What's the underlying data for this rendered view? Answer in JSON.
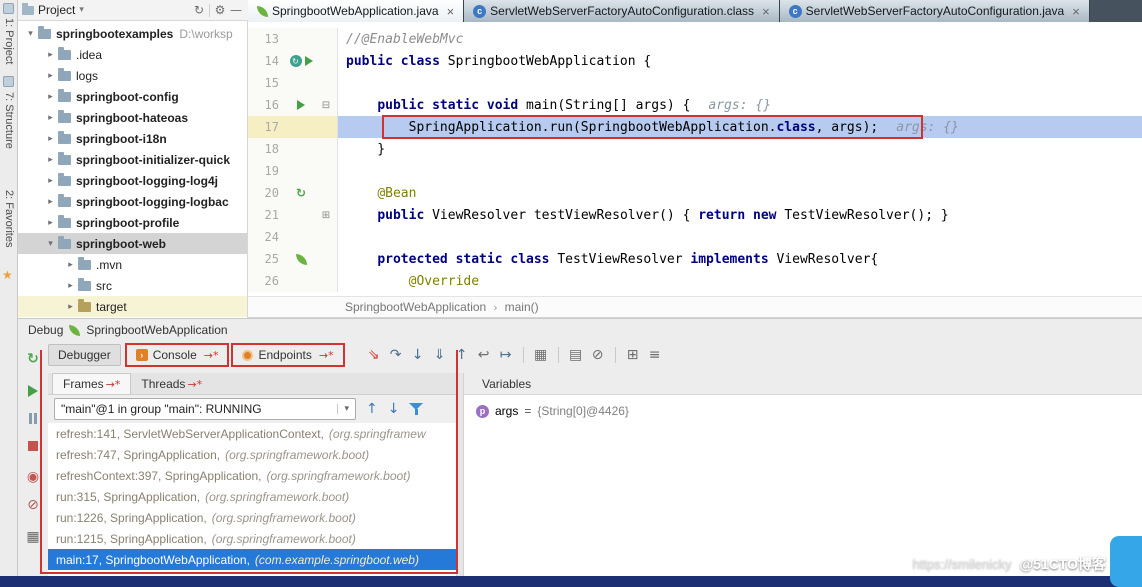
{
  "activity_bar": {
    "project_label": "1: Project",
    "structure_label": "7: Structure",
    "favorites_label": "2: Favorites",
    "star_icon": "★"
  },
  "project_toolbar": {
    "title": "Project",
    "caret": "▾",
    "icons": [
      {
        "name": "sync-icon",
        "g": "↻"
      },
      {
        "name": "settings-icon",
        "g": "⚙"
      },
      {
        "name": "hide-icon",
        "g": "—"
      }
    ]
  },
  "project_tree": {
    "root": {
      "name": "springbootexamples",
      "path": "D:\\worksp"
    },
    "items": [
      {
        "name": ".idea",
        "bold": false,
        "level": 1,
        "expanded": false
      },
      {
        "name": "logs",
        "bold": false,
        "level": 1,
        "expanded": false
      },
      {
        "name": "springboot-config",
        "bold": true,
        "level": 1,
        "expanded": false
      },
      {
        "name": "springboot-hateoas",
        "bold": true,
        "level": 1,
        "expanded": false
      },
      {
        "name": "springboot-i18n",
        "bold": true,
        "level": 1,
        "expanded": false
      },
      {
        "name": "springboot-initializer-quick",
        "bold": true,
        "level": 1,
        "expanded": false
      },
      {
        "name": "springboot-logging-log4j",
        "bold": true,
        "level": 1,
        "expanded": false
      },
      {
        "name": "springboot-logging-logbac",
        "bold": true,
        "level": 1,
        "expanded": false
      },
      {
        "name": "springboot-profile",
        "bold": true,
        "level": 1,
        "expanded": false
      },
      {
        "name": "springboot-web",
        "bold": true,
        "level": 1,
        "expanded": true,
        "selected": true
      },
      {
        "name": ".mvn",
        "bold": false,
        "level": 2,
        "expanded": false
      },
      {
        "name": "src",
        "bold": false,
        "level": 2,
        "expanded": false
      },
      {
        "name": "target",
        "bold": false,
        "level": 2,
        "expanded": false,
        "excluded": true,
        "olive": true
      }
    ]
  },
  "editor_tabs": [
    {
      "label": "SpringbootWebApplication.java",
      "icon": "leaf",
      "active": true
    },
    {
      "label": "ServletWebServerFactoryAutoConfiguration.class",
      "icon": "class",
      "active": false
    },
    {
      "label": "ServletWebServerFactoryAutoConfiguration.java",
      "icon": "class",
      "active": false
    }
  ],
  "editor": {
    "lines": [
      {
        "num": "13",
        "segments": [
          {
            "t": "//@EnableWebMvc",
            "s": "comment"
          }
        ]
      },
      {
        "num": "14",
        "gutter": [
          "rerun",
          "run"
        ],
        "segments": [
          {
            "t": "public class ",
            "s": "kw"
          },
          {
            "t": "SpringbootWebApplication {",
            "s": "plain"
          }
        ]
      },
      {
        "num": "15",
        "segments": []
      },
      {
        "num": "16",
        "gutter": [
          "run"
        ],
        "fold": "⊟",
        "segments": [
          {
            "t": "    ",
            "s": "plain"
          },
          {
            "t": "public static void ",
            "s": "kw"
          },
          {
            "t": "main(String[] args) {",
            "s": "plain"
          },
          {
            "t": "args: {}",
            "s": "hint"
          }
        ]
      },
      {
        "num": "17",
        "current": true,
        "segments": [
          {
            "t": "        ",
            "s": "plain"
          },
          {
            "t": "SpringApplication.run(SpringbootWebApplication.",
            "s": "plain"
          },
          {
            "t": "class",
            "s": "kw"
          },
          {
            "t": ", args);",
            "s": "plain"
          },
          {
            "t": "args: {}",
            "s": "hint"
          }
        ]
      },
      {
        "num": "18",
        "segments": [
          {
            "t": "    }",
            "s": "plain"
          }
        ]
      },
      {
        "num": "19",
        "segments": []
      },
      {
        "num": "20",
        "gutter": [
          "bean"
        ],
        "segments": [
          {
            "t": "    ",
            "s": "plain"
          },
          {
            "t": "@Bean",
            "s": "anno"
          }
        ]
      },
      {
        "num": "21",
        "fold": "⊞",
        "segments": [
          {
            "t": "    ",
            "s": "plain"
          },
          {
            "t": "public ",
            "s": "kw"
          },
          {
            "t": "ViewResolver testViewResolver() { ",
            "s": "plain"
          },
          {
            "t": "return new ",
            "s": "kw"
          },
          {
            "t": "TestViewResolver(); }",
            "s": "plain"
          }
        ]
      },
      {
        "num": "24",
        "segments": []
      },
      {
        "num": "25",
        "gutter": [
          "leaf"
        ],
        "segments": [
          {
            "t": "    ",
            "s": "plain"
          },
          {
            "t": "protected static class ",
            "s": "kw"
          },
          {
            "t": "TestViewResolver ",
            "s": "plain"
          },
          {
            "t": "implements ",
            "s": "kw"
          },
          {
            "t": "ViewResolver{",
            "s": "plain"
          }
        ]
      },
      {
        "num": "26",
        "segments": [
          {
            "t": "        ",
            "s": "plain"
          },
          {
            "t": "@Override",
            "s": "anno"
          }
        ]
      }
    ]
  },
  "breadcrumb": {
    "items": [
      "SpringbootWebApplication",
      "main()"
    ],
    "separator": "›"
  },
  "debug": {
    "header": {
      "label": "Debug",
      "session": "SpringbootWebApplication"
    },
    "tabs": [
      {
        "label": "Debugger",
        "icon": null,
        "selected": true,
        "annotated": false
      },
      {
        "label": "Console",
        "icon": "console",
        "selected": false,
        "annotated": true
      },
      {
        "label": "Endpoints",
        "icon": "endpoints",
        "selected": false,
        "annotated": true
      }
    ],
    "toolbar_icons": [
      {
        "name": "show-execution-point-icon",
        "g": "⇘",
        "style": "red"
      },
      {
        "name": "step-over-icon",
        "g": "↷",
        "style": "blue"
      },
      {
        "name": "step-into-icon",
        "g": "↓",
        "style": "blue"
      },
      {
        "name": "force-step-into-icon",
        "g": "⇓",
        "style": "blue"
      },
      {
        "name": "step-out-icon",
        "g": "↑",
        "style": "blue"
      },
      {
        "name": "drop-frame-icon",
        "g": "↩",
        "style": "gray"
      },
      {
        "name": "run-to-cursor-icon",
        "g": "↦",
        "style": "blue"
      },
      {
        "name": "sep",
        "g": "",
        "style": "sep"
      },
      {
        "name": "evaluate-expression-icon",
        "g": "▦",
        "style": "gray"
      },
      {
        "name": "sep",
        "g": "",
        "style": "sep"
      },
      {
        "name": "thread-dump-icon",
        "g": "▤",
        "style": "gray"
      },
      {
        "name": "mute-breakpoints-icon",
        "g": "⊘",
        "style": "gray"
      },
      {
        "name": "sep",
        "g": "",
        "style": "sep"
      },
      {
        "name": "layout-icon",
        "g": "⊞",
        "style": "gray"
      },
      {
        "name": "restore-layout-icon",
        "g": "≡",
        "style": "gray"
      }
    ],
    "control_icons": [
      {
        "name": "rerun-debug-icon",
        "kind": "rerun",
        "g": "↻"
      },
      {
        "name": "resume-icon",
        "kind": "resume"
      },
      {
        "name": "pause-icon",
        "kind": "pause"
      },
      {
        "name": "stop-icon",
        "kind": "stop"
      },
      {
        "name": "view-breakpoints-icon",
        "kind": "glyph",
        "g": "◉",
        "color": "#C4524E"
      },
      {
        "name": "mute-breakpoints-icon",
        "kind": "glyph",
        "g": "⊘",
        "color": "#B05A56"
      },
      {
        "name": "settings-grid-icon",
        "kind": "glyph",
        "g": "▦",
        "color": "#6A6A6A"
      }
    ],
    "frames_tabs": [
      {
        "label": "Frames",
        "selected": true,
        "annotated": true
      },
      {
        "label": "Threads",
        "selected": false,
        "annotated": true
      }
    ],
    "thread_selector": "\"main\"@1 in group \"main\": RUNNING",
    "frames": [
      {
        "text": "refresh:141, ServletWebServerApplicationContext",
        "pkg": "(org.springframew",
        "selected": false
      },
      {
        "text": "refresh:747, SpringApplication",
        "pkg": "(org.springframework.boot)",
        "selected": false
      },
      {
        "text": "refreshContext:397, SpringApplication",
        "pkg": "(org.springframework.boot)",
        "selected": false
      },
      {
        "text": "run:315, SpringApplication",
        "pkg": "(org.springframework.boot)",
        "selected": false
      },
      {
        "text": "run:1226, SpringApplication",
        "pkg": "(org.springframework.boot)",
        "selected": false
      },
      {
        "text": "run:1215, SpringApplication",
        "pkg": "(org.springframework.boot)",
        "selected": false
      },
      {
        "text": "main:17, SpringbootWebApplication",
        "pkg": "(com.example.springboot.web)",
        "selected": true
      }
    ],
    "variables": {
      "title": "Variables",
      "rows": [
        {
          "icon": "p",
          "name": "args",
          "eq": " = ",
          "value": "{String[0]@4426}"
        }
      ]
    }
  },
  "annotations": {
    "red_mark": "→*"
  },
  "watermark": {
    "url": "https://smilenicky",
    "site": "@51CTO博客"
  }
}
